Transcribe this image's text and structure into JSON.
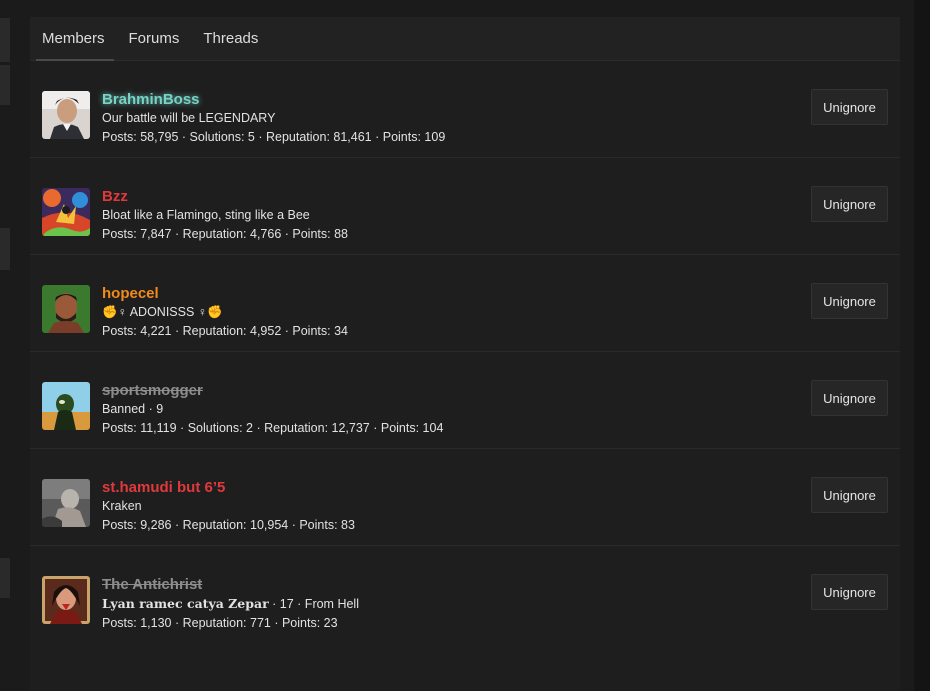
{
  "tabs": [
    "Members",
    "Forums",
    "Threads"
  ],
  "ignore_label": "Unignore",
  "members": [
    {
      "name": "BrahminBoss",
      "subtitle": "Our battle will be LEGENDARY",
      "stats": "Posts: 58,795 · Solutions: 5 · Reputation: 81,461 · Points: 109"
    },
    {
      "name": "Bzz",
      "subtitle": "Bloat like a Flamingo, sting like a Bee",
      "stats": "Posts: 7,847 · Reputation: 4,766 · Points: 88"
    },
    {
      "name": "hopecel",
      "subtitle": "✊♀ ADONISSS ♀✊",
      "stats": "Posts: 4,221 · Reputation: 4,952 · Points: 34"
    },
    {
      "name": "sportsmogger",
      "subtitle": "Banned · 9",
      "stats": "Posts: 11,119 · Solutions: 2 · Reputation: 12,737 · Points: 104"
    },
    {
      "name": "st.hamudi but 6’5",
      "subtitle": "Kraken",
      "stats": "Posts: 9,286 · Reputation: 10,954 · Points: 83"
    },
    {
      "name": "The Antichrist",
      "subtitle_title": "Lyan ramec catya Zepar",
      "subtitle_rest": " · 17 · From Hell",
      "stats": "Posts: 1,130 · Reputation: 771 · Points: 23"
    }
  ],
  "colors": {
    "brahminboss": "#77d3c6",
    "bzz": "#e0393c",
    "hopecel": "#f28a1c",
    "banned": "#8d8d8d",
    "sthamudi": "#e0393c"
  }
}
